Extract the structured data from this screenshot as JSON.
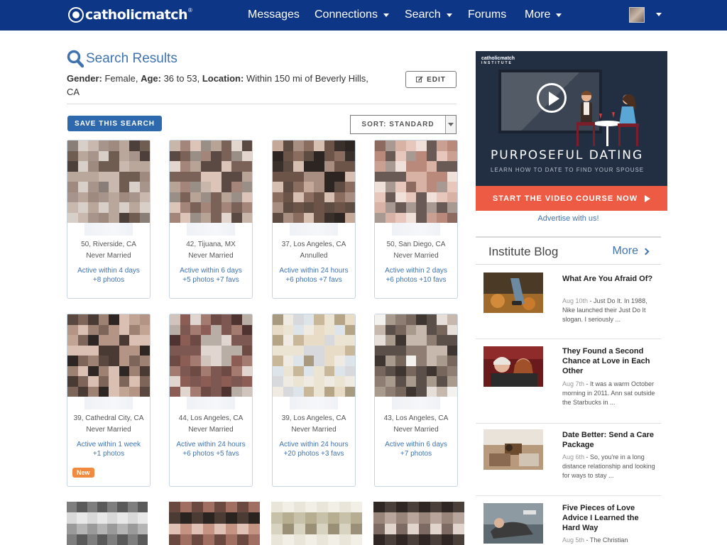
{
  "nav": {
    "logo_text": "catholicmatch",
    "logo_reg": "®",
    "items": [
      "Messages",
      "Connections",
      "Search",
      "Forums",
      "More"
    ]
  },
  "header": {
    "title": "Search Results",
    "criteria": {
      "gender_label": "Gender:",
      "gender": "Female,",
      "age_label": "Age:",
      "age": "36 to 53,",
      "location_label": "Location:",
      "location": "Within 150 mi of Beverly Hills, CA"
    },
    "edit_label": "EDIT",
    "save_label": "SAVE THIS SEARCH",
    "sort_label": "SORT: STANDARD"
  },
  "results": [
    {
      "location": "50, Riverside, CA",
      "status": "Never Married",
      "active": "Active within 4 days",
      "photos": "+8 photos"
    },
    {
      "location": "42, Tijuana, MX",
      "status": "Never Married",
      "active": "Active within 6 days",
      "photos": "+5 photos +7 favs"
    },
    {
      "location": "37, Los Angeles, CA",
      "status": "Annulled",
      "active": "Active within 24 hours",
      "photos": "+6 photos +7 favs"
    },
    {
      "location": "50, San Diego, CA",
      "status": "Never Married",
      "active": "Active within 2 days",
      "photos": "+6 photos +10 favs"
    },
    {
      "location": "39, Cathedral City, CA",
      "status": "Never Married",
      "active": "Active within 1 week",
      "photos": "+1 photos",
      "badge": "New"
    },
    {
      "location": "44, Los Angeles, CA",
      "status": "Never Married",
      "active": "Active within 24 hours",
      "photos": "+6 photos +5 favs"
    },
    {
      "location": "39, Los Angeles, CA",
      "status": "Never Married",
      "active": "Active within 24 hours",
      "photos": "+20 photos +3 favs"
    },
    {
      "location": "43, Los Angeles, CA",
      "status": "Never Married",
      "active": "Active within 6 days",
      "photos": "+7 photos"
    }
  ],
  "ad": {
    "logo": "catholicmatch",
    "logo_sub": "INSTITUTE",
    "headline": "PURPOSEFUL DATING",
    "subline": "LEARN HOW TO DATE TO FIND YOUR SPOUSE",
    "cta": "START THE VIDEO COURSE NOW",
    "advertise": "Advertise with us!"
  },
  "blog": {
    "title": "Institute Blog",
    "more": "More",
    "posts": [
      {
        "title": "What Are You Afraid Of?",
        "date": "Aug 10th",
        "excerpt": " - Just Do It. In 1988, Nike launched their Just Do It slogan. I seriously ..."
      },
      {
        "title": "They Found a Second Chance at Love in Each Other",
        "date": "Aug 7th",
        "excerpt": " - It was a warm October morning in 2011. Ann sat outside the Starbucks in ..."
      },
      {
        "title": "Date Better: Send a Care Package",
        "date": "Aug 6th",
        "excerpt": " - So, you're in a long distance relationship and looking for ways to stay ..."
      },
      {
        "title": "Five Pieces of Love Advice I Learned the Hard Way",
        "date": "Aug 5th",
        "excerpt": " - The Christian"
      }
    ]
  },
  "colors": {
    "nav": "#0d3687",
    "accent": "#3f73b0",
    "cta": "#ee5b45",
    "badge": "#f08a3e"
  }
}
